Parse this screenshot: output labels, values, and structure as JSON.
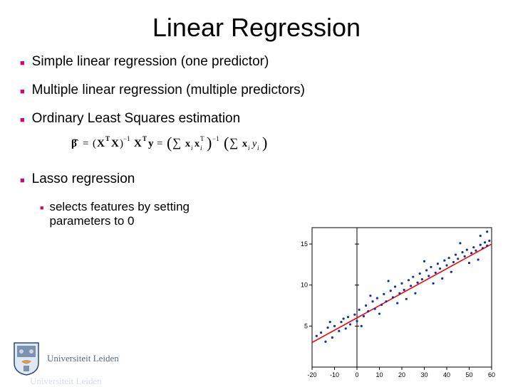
{
  "title": "Linear Regression",
  "bullets": {
    "b1": "Simple linear regression (one predictor)",
    "b2": "Multiple linear regression (multiple predictors)",
    "b3": "Ordinary Least Squares estimation",
    "b4": "Lasso regression",
    "b4_sub": "selects features by setting parameters to 0"
  },
  "formula": {
    "latex": "\\hat{\\boldsymbol\\beta} = (\\mathbf{X}^{\\mathrm T}\\mathbf{X})^{-1}\\mathbf{X}^{\\mathrm T}\\mathbf{y} = \\left(\\sum \\mathbf{x}_i \\mathbf{x}_i^{\\mathrm T}\\right)^{-1} \\left(\\sum \\mathbf{x}_i y_i\\right)"
  },
  "logo": {
    "institution": "Universiteit Leiden"
  },
  "chart_data": {
    "type": "scatter",
    "title": "",
    "xlabel": "",
    "ylabel": "",
    "xlim": [
      -20,
      60
    ],
    "ylim": [
      0,
      17
    ],
    "xticks": [
      -20,
      -10,
      0,
      10,
      20,
      30,
      40,
      50,
      60
    ],
    "yticks": [
      5,
      10,
      15
    ],
    "grid": false,
    "fit_line": {
      "color": "red",
      "x": [
        -20,
        60
      ],
      "y": [
        3.0,
        15.0
      ]
    },
    "points": [
      {
        "x": -18,
        "y": 3.8
      },
      {
        "x": -16,
        "y": 4.2
      },
      {
        "x": -14,
        "y": 3.1
      },
      {
        "x": -13,
        "y": 4.8
      },
      {
        "x": -11,
        "y": 3.6
      },
      {
        "x": -10,
        "y": 5.0
      },
      {
        "x": -8,
        "y": 4.4
      },
      {
        "x": -7,
        "y": 5.5
      },
      {
        "x": -5,
        "y": 4.7
      },
      {
        "x": -4,
        "y": 6.1
      },
      {
        "x": -3,
        "y": 5.2
      },
      {
        "x": -1,
        "y": 6.4
      },
      {
        "x": 0,
        "y": 5.6
      },
      {
        "x": 1,
        "y": 7.0
      },
      {
        "x": 3,
        "y": 6.2
      },
      {
        "x": 4,
        "y": 7.5
      },
      {
        "x": 5,
        "y": 6.8
      },
      {
        "x": 7,
        "y": 8.0
      },
      {
        "x": 8,
        "y": 7.1
      },
      {
        "x": 9,
        "y": 8.4
      },
      {
        "x": 11,
        "y": 7.6
      },
      {
        "x": 12,
        "y": 8.9
      },
      {
        "x": 13,
        "y": 8.0
      },
      {
        "x": 15,
        "y": 9.3
      },
      {
        "x": 16,
        "y": 8.5
      },
      {
        "x": 17,
        "y": 9.8
      },
      {
        "x": 19,
        "y": 9.0
      },
      {
        "x": 20,
        "y": 10.2
      },
      {
        "x": 21,
        "y": 9.4
      },
      {
        "x": 23,
        "y": 10.6
      },
      {
        "x": 24,
        "y": 9.9
      },
      {
        "x": 25,
        "y": 11.0
      },
      {
        "x": 27,
        "y": 10.3
      },
      {
        "x": 28,
        "y": 11.4
      },
      {
        "x": 29,
        "y": 10.7
      },
      {
        "x": 31,
        "y": 11.8
      },
      {
        "x": 32,
        "y": 11.1
      },
      {
        "x": 33,
        "y": 12.2
      },
      {
        "x": 35,
        "y": 11.5
      },
      {
        "x": 36,
        "y": 12.6
      },
      {
        "x": 37,
        "y": 12.0
      },
      {
        "x": 39,
        "y": 13.0
      },
      {
        "x": 40,
        "y": 12.4
      },
      {
        "x": 41,
        "y": 13.3
      },
      {
        "x": 43,
        "y": 12.8
      },
      {
        "x": 44,
        "y": 13.7
      },
      {
        "x": 45,
        "y": 13.2
      },
      {
        "x": 47,
        "y": 14.0
      },
      {
        "x": 48,
        "y": 13.5
      },
      {
        "x": 49,
        "y": 14.3
      },
      {
        "x": 51,
        "y": 13.9
      },
      {
        "x": 52,
        "y": 14.6
      },
      {
        "x": 53,
        "y": 14.2
      },
      {
        "x": 55,
        "y": 14.9
      },
      {
        "x": 56,
        "y": 14.5
      },
      {
        "x": 57,
        "y": 15.2
      },
      {
        "x": 58,
        "y": 14.8
      },
      {
        "x": 59,
        "y": 15.4
      },
      {
        "x": -6,
        "y": 5.9
      },
      {
        "x": 2,
        "y": 5.0
      },
      {
        "x": 10,
        "y": 6.5
      },
      {
        "x": 18,
        "y": 7.8
      },
      {
        "x": 26,
        "y": 9.0
      },
      {
        "x": 34,
        "y": 10.2
      },
      {
        "x": 42,
        "y": 11.6
      },
      {
        "x": 50,
        "y": 12.7
      },
      {
        "x": -12,
        "y": 5.5
      },
      {
        "x": 6,
        "y": 8.7
      },
      {
        "x": 14,
        "y": 10.5
      },
      {
        "x": 22,
        "y": 8.3
      },
      {
        "x": 30,
        "y": 12.9
      },
      {
        "x": 38,
        "y": 10.8
      },
      {
        "x": 46,
        "y": 15.1
      },
      {
        "x": 54,
        "y": 13.1
      },
      {
        "x": 55,
        "y": 16.0
      },
      {
        "x": 58,
        "y": 16.5
      }
    ]
  }
}
